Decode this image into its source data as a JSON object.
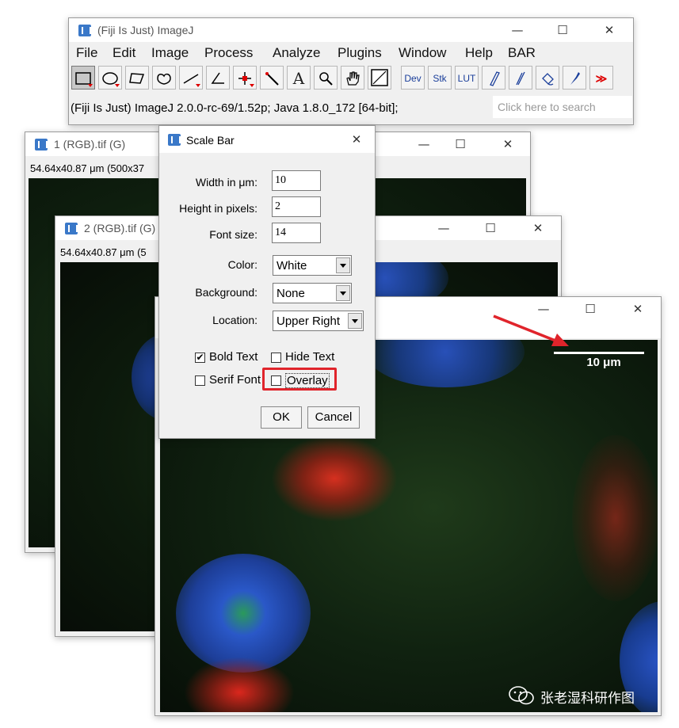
{
  "imagej": {
    "title": "(Fiji Is Just) ImageJ",
    "menus": [
      "File",
      "Edit",
      "Image",
      "Process",
      "Analyze",
      "Plugins",
      "Window",
      "Help",
      "BAR"
    ],
    "tools": {
      "dev": "Dev",
      "stk": "Stk",
      "lut": "LUT",
      "text": "A",
      "more": "≫"
    },
    "status": "(Fiji Is Just) ImageJ 2.0.0-rc-69/1.52p; Java 1.8.0_172 [64-bit];",
    "search_placeholder": "Click here to search"
  },
  "window_controls": {
    "minimize": "—",
    "maximize": "☐",
    "close": "✕"
  },
  "image1": {
    "title": "1 (RGB).tif (G)",
    "info": "54.64x40.87 μm (500x37"
  },
  "image2": {
    "title": "2 (RGB).tif (G)",
    "info": "54.64x40.87 μm (5"
  },
  "image3": {
    "scale_label": "10 μm"
  },
  "dialog": {
    "title": "Scale Bar",
    "fields": [
      {
        "label": "Width in μm:",
        "value": "10"
      },
      {
        "label": "Height in pixels:",
        "value": "2"
      },
      {
        "label": "Font size:",
        "value": "14"
      }
    ],
    "choices": [
      {
        "label": "Color:",
        "value": "White"
      },
      {
        "label": "Background:",
        "value": "None"
      },
      {
        "label": "Location:",
        "value": "Upper Right"
      }
    ],
    "checkboxes": [
      {
        "label": "Bold Text",
        "checked": true
      },
      {
        "label": "Hide Text",
        "checked": false
      },
      {
        "label": "Serif Font",
        "checked": false
      },
      {
        "label": "Overlay",
        "checked": false
      }
    ],
    "ok_label": "OK",
    "cancel_label": "Cancel",
    "checked_mark": "✔"
  },
  "watermark": "张老湿科研作图",
  "colors": {
    "highlight": "#e0242b",
    "arrow": "#e0242b",
    "nucleus": "#2a55c8",
    "actin": "#e03020"
  }
}
